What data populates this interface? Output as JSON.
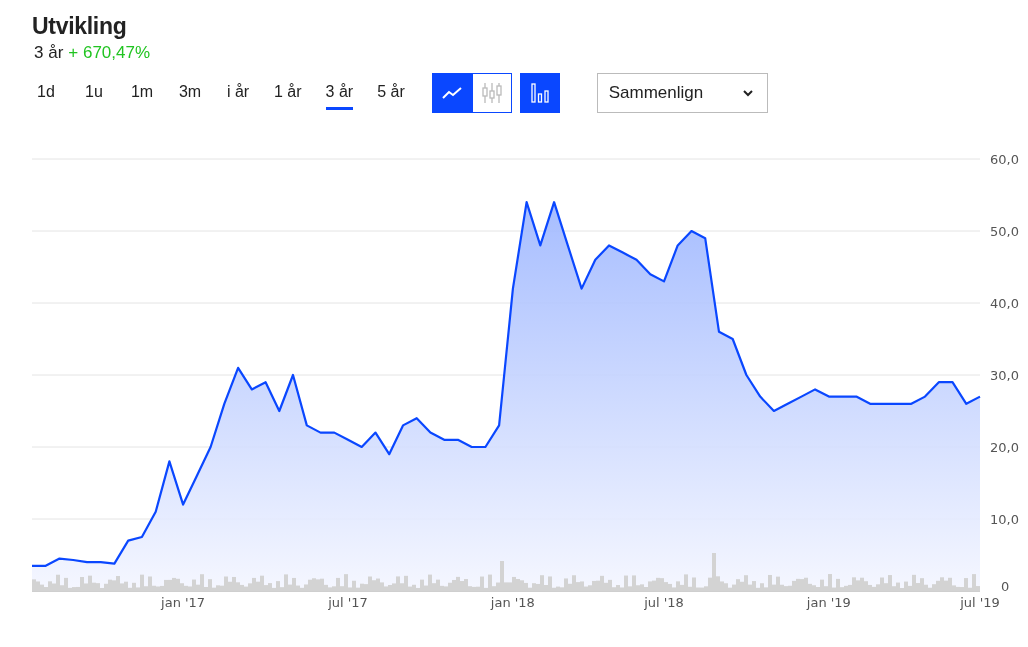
{
  "title": "Utvikling",
  "change": {
    "period": "3 år",
    "value": "+ 670,47%"
  },
  "ranges": [
    {
      "label": "1d",
      "selected": false
    },
    {
      "label": "1u",
      "selected": false
    },
    {
      "label": "1m",
      "selected": false
    },
    {
      "label": "3m",
      "selected": false
    },
    {
      "label": "i år",
      "selected": false
    },
    {
      "label": "1 år",
      "selected": false
    },
    {
      "label": "3 år",
      "selected": true
    },
    {
      "label": "5 år",
      "selected": false
    }
  ],
  "chart_types": [
    {
      "kind": "line",
      "selected": true
    },
    {
      "kind": "candlestick",
      "selected": false
    }
  ],
  "volume_toggle": {
    "on": true
  },
  "compare_dropdown": {
    "label": "Sammenlign"
  },
  "chart": {
    "chart_data": {
      "type": "area",
      "grid": true,
      "ylim": [
        0,
        60
      ],
      "categories": [
        null,
        null,
        null,
        null,
        null,
        null,
        null,
        null,
        null,
        null,
        null,
        "jan '17",
        null,
        null,
        null,
        null,
        null,
        null,
        null,
        null,
        null,
        null,
        null,
        "jul '17",
        null,
        null,
        null,
        null,
        null,
        null,
        null,
        null,
        null,
        null,
        null,
        "jan '18",
        null,
        null,
        null,
        null,
        null,
        null,
        null,
        null,
        null,
        null,
        "jul '18",
        null,
        null,
        null,
        null,
        null,
        null,
        null,
        null,
        null,
        null,
        null,
        "jan '19",
        null,
        null,
        null,
        null,
        null,
        null,
        null,
        null,
        null,
        null,
        "jul '19"
      ],
      "yticks": [
        {
          "value": 60,
          "label": "60,0"
        },
        {
          "value": 50,
          "label": "50,0"
        },
        {
          "value": 40,
          "label": "40,0"
        },
        {
          "value": 30,
          "label": "30,0"
        },
        {
          "value": 20,
          "label": "20,0"
        },
        {
          "value": 10,
          "label": "10,0"
        },
        {
          "value": 0,
          "label": "0"
        }
      ],
      "values": [
        3.5,
        3.5,
        4.5,
        4.3,
        4,
        4,
        3.8,
        7,
        7.5,
        11,
        18,
        12,
        16,
        20,
        26,
        31,
        28,
        29,
        25,
        30,
        23,
        22,
        22,
        21,
        20,
        22,
        19,
        23,
        24,
        22,
        21,
        21,
        20,
        20,
        23,
        42,
        54,
        48,
        54,
        48,
        42,
        46,
        48,
        47,
        46,
        44,
        43,
        48,
        50,
        49,
        36,
        35,
        30,
        27,
        25,
        26,
        27,
        28,
        27,
        27,
        27,
        26,
        26,
        26,
        26,
        27,
        29,
        29,
        26,
        27
      ]
    }
  }
}
